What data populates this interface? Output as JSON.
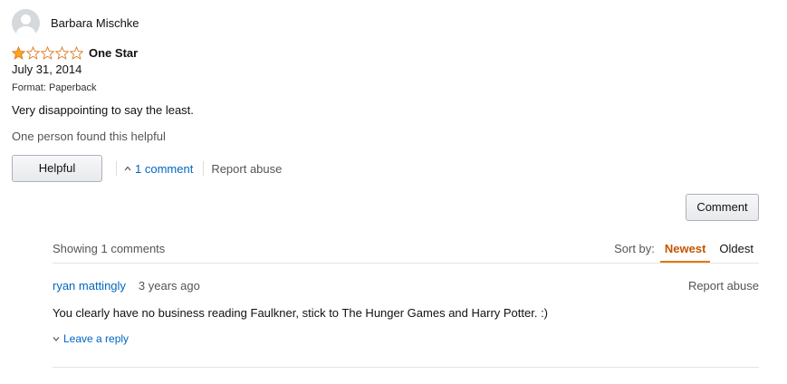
{
  "reviewer": {
    "name": "Barbara Mischke",
    "avatar_icon": "user-avatar-icon"
  },
  "review": {
    "rating": 1,
    "max_rating": 5,
    "star_color": "#ffa41c",
    "title": "One Star",
    "date": "July 31, 2014",
    "format": "Format: Paperback",
    "body": "Very disappointing to say the least.",
    "helpful_text": "One person found this helpful"
  },
  "actions": {
    "helpful_label": "Helpful",
    "comments_link": "1 comment",
    "report_abuse": "Report abuse",
    "comment_button": "Comment"
  },
  "comments": {
    "showing": "Showing 1 comments",
    "sort_label": "Sort by:",
    "sort_newest": "Newest",
    "sort_oldest": "Oldest",
    "active_sort": "Newest",
    "items": [
      {
        "author": "ryan mattingly",
        "time": "3 years ago",
        "report_abuse": "Report abuse",
        "text": "You clearly have no business reading Faulkner, stick to The Hunger Games and Harry Potter. :)",
        "reply_label": "Leave a reply"
      }
    ]
  }
}
